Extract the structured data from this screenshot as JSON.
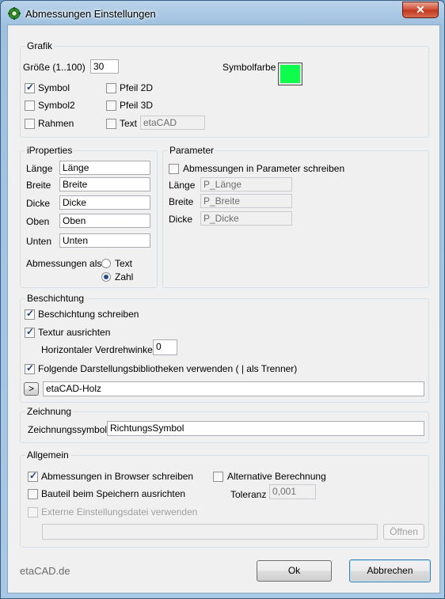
{
  "window": {
    "title": "Abmessungen Einstellungen",
    "close_symbol": "✕"
  },
  "grafik": {
    "title": "Grafik",
    "size_label": "Größe (1..100)",
    "size_value": "30",
    "symbolfarbe_label": "Symbolfarbe",
    "symbolfarbe_color": "#0EFC4B",
    "symbol": {
      "label": "Symbol",
      "checked": true
    },
    "symbol2": {
      "label": "Symbol2",
      "checked": false
    },
    "rahmen": {
      "label": "Rahmen",
      "checked": false
    },
    "pfeil2d": {
      "label": "Pfeil 2D",
      "checked": false
    },
    "pfeil3d": {
      "label": "Pfeil 3D",
      "checked": false
    },
    "text": {
      "label": "Text",
      "checked": false,
      "value": "etaCAD"
    }
  },
  "iproperties": {
    "title": "iProperties",
    "rows": [
      {
        "label": "Länge",
        "value": "Länge"
      },
      {
        "label": "Breite",
        "value": "Breite"
      },
      {
        "label": "Dicke",
        "value": "Dicke"
      },
      {
        "label": "Oben",
        "value": "Oben"
      },
      {
        "label": "Unten",
        "value": "Unten"
      }
    ],
    "abmessungen_als_label": "Abmessungen als:",
    "radio_text": "Text",
    "radio_zahl": "Zahl",
    "selected": "Zahl"
  },
  "parameter": {
    "title": "Parameter",
    "write_label": "Abmessungen in Parameter schreiben",
    "write_checked": false,
    "rows": [
      {
        "label": "Länge",
        "value": "P_Länge"
      },
      {
        "label": "Breite",
        "value": "P_Breite"
      },
      {
        "label": "Dicke",
        "value": "P_Dicke"
      }
    ]
  },
  "beschichtung": {
    "title": "Beschichtung",
    "schreiben": {
      "label": "Beschichtung schreiben",
      "checked": true
    },
    "textur": {
      "label": "Textur ausrichten",
      "checked": true
    },
    "verdrehwinkel_label": "Horizontaler Verdrehwinkel",
    "verdrehwinkel_value": "0",
    "bibliotheken": {
      "label": "Folgende Darstellungsbibliotheken verwenden ( | als Trenner)",
      "checked": true
    },
    "expand_label": ">",
    "bibliotheken_value": "etaCAD-Holz"
  },
  "zeichnung": {
    "title": "Zeichnung",
    "symbol_label": "Zeichnungssymbol",
    "symbol_value": "RichtungsSymbol"
  },
  "allgemein": {
    "title": "Allgemein",
    "browser": {
      "label": "Abmessungen in Browser schreiben",
      "checked": true
    },
    "speichern": {
      "label": "Bauteil beim Speichern ausrichten",
      "checked": false
    },
    "alternative": {
      "label": "Alternative Berechnung",
      "checked": false
    },
    "toleranz_label": "Toleranz",
    "toleranz_value": "0,001",
    "extern": {
      "label": "Externe Einstellungsdatei verwenden",
      "checked": false,
      "disabled": true
    },
    "file_path": "",
    "oeffnen_label": "Öffnen"
  },
  "footer": {
    "brand": "etaCAD.de",
    "ok_label": "Ok",
    "cancel_label": "Abbrechen"
  }
}
